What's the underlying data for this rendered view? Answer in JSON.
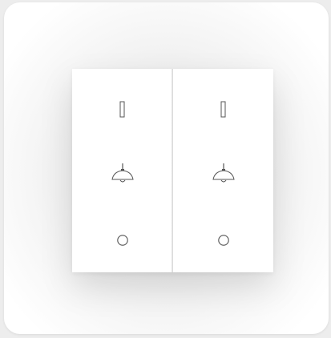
{
  "panel": {
    "gangs": [
      {
        "name": "left",
        "icons": [
          "on-mark-icon",
          "pendant-lamp-icon",
          "off-mark-icon"
        ]
      },
      {
        "name": "right",
        "icons": [
          "on-mark-icon",
          "pendant-lamp-icon",
          "off-mark-icon"
        ]
      }
    ]
  },
  "colors": {
    "plate": "#f7f7f7",
    "rocker": "#ffffff",
    "icon_stroke": "#555555"
  }
}
